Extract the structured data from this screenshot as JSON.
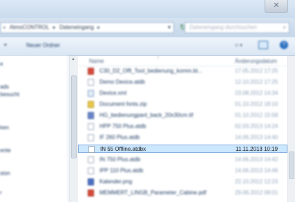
{
  "window": {
    "close_glyph": "✕"
  },
  "address": {
    "crumbs": [
      "AtmoCONTROL",
      "Dateneingang"
    ],
    "lead_glyph": "«",
    "sep_glyph": "▸",
    "dropdown_glyph": "▾",
    "refresh_glyph": "↻"
  },
  "search": {
    "placeholder": "Dateneingang durchsuchen",
    "icon_glyph": "⌕"
  },
  "toolbar": {
    "new_folder_label": "Neuer Ordner",
    "view_glyph": "≡ ▾",
    "help_glyph": "?"
  },
  "nav": {
    "items": [
      {
        "label": "e"
      },
      {
        "label": "ads"
      },
      {
        "label": "besucht"
      },
      {
        "label": "ken"
      },
      {
        "label": "ente"
      },
      {
        "label": "sion"
      },
      {
        "label": "r"
      }
    ]
  },
  "columns": {
    "name": "Name",
    "date": "Änderungsdatum",
    "sort_glyph": "˄"
  },
  "files": [
    {
      "name": "C30_D2_Offl_Tool_bedienung_komm.bt...",
      "date": "17.05.2012 17:25",
      "type": "pdf",
      "blurred": true
    },
    {
      "name": "Demo Device.atdb",
      "date": "12.10.2012 17:25",
      "type": "file",
      "blurred": true
    },
    {
      "name": "Device.xml",
      "date": "23.08.2012 14:34",
      "type": "xml",
      "blurred": true
    },
    {
      "name": "Document fonts.zip",
      "date": "01.10.2012 18:10",
      "type": "zip",
      "blurred": true
    },
    {
      "name": "HG_bedienungpanl_back_20x30cm.tif",
      "date": "01.10.2012 15:58",
      "type": "tif",
      "blurred": true
    },
    {
      "name": "HPP 750 Plus.atdb",
      "date": "02.03.2013 14:24",
      "type": "file",
      "blurred": true
    },
    {
      "name": "IF 260 Plus.atdb",
      "date": "14.06.2013 14:40",
      "type": "file",
      "blurred": true
    },
    {
      "name": "IN 55 Offline.atdbx",
      "date": "11.11.2013 10:19",
      "type": "file",
      "blurred": false,
      "selected": true
    },
    {
      "name": "IN 750 Plus.atdb",
      "date": "14.06.2013 14:42",
      "type": "file",
      "blurred": true
    },
    {
      "name": "IPP 110 Plus.atdb",
      "date": "14.06.2013 14:46",
      "type": "file",
      "blurred": true
    },
    {
      "name": "Kalender.png",
      "date": "22.10.2012 12:23",
      "type": "img",
      "blurred": true
    },
    {
      "name": "MEMMERT_LINGB_Parameter_Cabine.pdf",
      "date": "29.06.2012 08:01",
      "type": "pdf",
      "blurred": true
    }
  ]
}
